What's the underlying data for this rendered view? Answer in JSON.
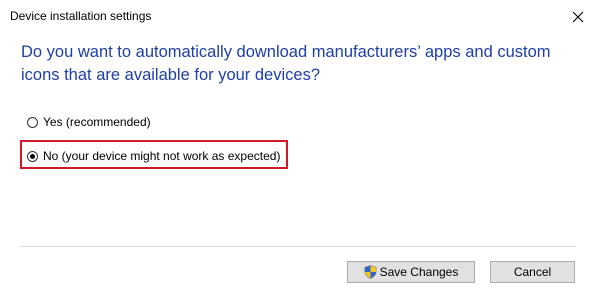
{
  "window": {
    "title": "Device installation settings"
  },
  "question": "Do you want to automatically download manufacturers’ apps and custom icons that are available for your devices?",
  "options": [
    {
      "label": "Yes (recommended)",
      "selected": false
    },
    {
      "label": "No (your device might not work as expected)",
      "selected": true
    }
  ],
  "buttons": {
    "save": "Save Changes",
    "cancel": "Cancel"
  },
  "icons": {
    "close": "close-icon",
    "shield": "uac-shield-icon"
  },
  "colors": {
    "question_text": "#1e3ea8",
    "highlight_border": "#d01a2a"
  }
}
